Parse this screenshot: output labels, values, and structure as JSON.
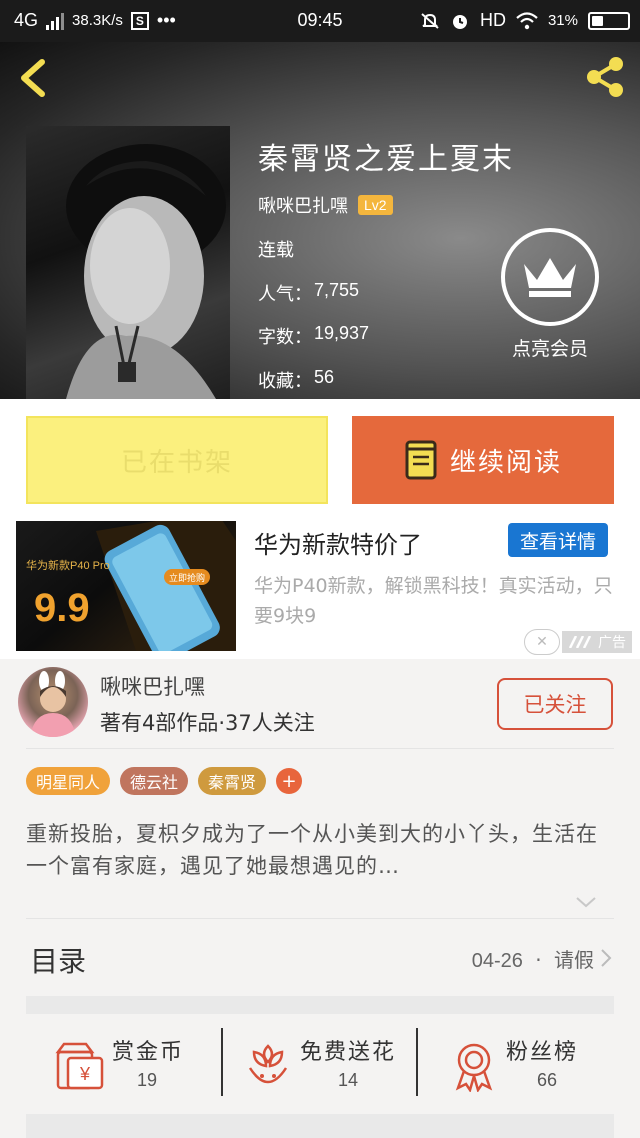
{
  "status_bar": {
    "network": "4G",
    "speed": "38.3K/s",
    "app_badge": "S",
    "more": "•••",
    "time": "09:45",
    "hd": "HD",
    "battery": "31%",
    "battery_level": 0.31
  },
  "book": {
    "title": "秦霄贤之爱上夏末",
    "author": "啾咪巴扎嘿",
    "level": "Lv2",
    "status": "连载",
    "popularity_label": "人气：",
    "popularity": "7,755",
    "word_count_label": "字数：",
    "word_count": "19,937",
    "favorites_label": "收藏：",
    "favorites": "56",
    "vip_label": "点亮会员"
  },
  "actions": {
    "on_shelf": "已在书架",
    "continue_reading": "继续阅读"
  },
  "ad": {
    "title": "华为新款特价了",
    "cta": "查看详情",
    "description": "华为P40新款，解锁黑科技！真实活动，只要9块9",
    "image_caption": "华为新款P40 Pro",
    "image_price": "9.9",
    "image_button": "立即抢购",
    "label": "广告"
  },
  "author": {
    "name": "啾咪巴扎嘿",
    "stats": "著有4部作品·37人关注",
    "follow": "已关注"
  },
  "tags": [
    {
      "label": "明星同人",
      "color": "#f0a23b"
    },
    {
      "label": "德云社",
      "color": "#c0755e"
    },
    {
      "label": "秦霄贤",
      "color": "#cf9a3e"
    }
  ],
  "tag_add": "+",
  "synopsis": "重新投胎，夏枳夕成为了一个从小美到大的小丫头，生活在一个富有家庭，遇见了她最想遇见的…",
  "toc": {
    "title": "目录",
    "latest_date": "04-26",
    "latest_sep": "·",
    "latest_chapter": "请假"
  },
  "stats": [
    {
      "label": "赏金币",
      "value": "19"
    },
    {
      "label": "免费送花",
      "value": "14"
    },
    {
      "label": "粉丝榜",
      "value": "66"
    }
  ],
  "colors": {
    "accent": "#e5693c",
    "shelf": "#fbf07e",
    "cta_blue": "#1976d2",
    "icon_red": "#d6513a"
  }
}
